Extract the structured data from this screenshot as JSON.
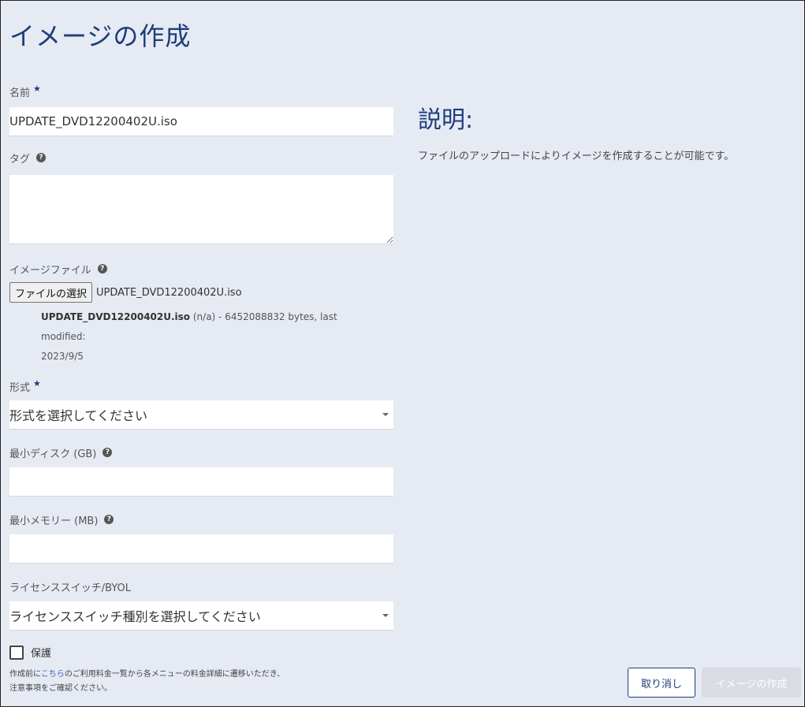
{
  "page": {
    "title": "イメージの作成"
  },
  "form": {
    "name": {
      "label": "名前",
      "required_mark": "★",
      "value": "UPDATE_DVD12200402U.iso"
    },
    "tags": {
      "label": "タグ",
      "help": "?",
      "value": ""
    },
    "image_file": {
      "label": "イメージファイル",
      "help": "?",
      "button_label": "ファイルの選択",
      "selected_name": "UPDATE_DVD12200402U.iso",
      "info_name": "UPDATE_DVD12200402U.iso",
      "info_detail": " (n/a) - 6452088832 bytes, last modified:",
      "info_date": "2023/9/5"
    },
    "format": {
      "label": "形式",
      "required_mark": "★",
      "selected": "形式を選択してください"
    },
    "min_disk": {
      "label": "最小ディスク (GB)",
      "help": "?",
      "value": ""
    },
    "min_memory": {
      "label": "最小メモリー (MB)",
      "help": "?",
      "value": ""
    },
    "license": {
      "label": "ライセンススイッチ/BYOL",
      "selected": "ライセンススイッチ種別を選択してください"
    },
    "protect": {
      "label": "保護",
      "checked": false
    }
  },
  "description": {
    "title": "説明:",
    "text": "ファイルのアップロードによりイメージを作成することが可能です。"
  },
  "footer": {
    "note_prefix": "作成前に",
    "note_link": "こちら",
    "note_line1_rest": "のご利用料金一覧から各メニューの料金詳細に遷移いただき、",
    "note_line2": "注意事項をご確認ください。",
    "cancel_label": "取り消し",
    "create_label": "イメージの作成"
  }
}
